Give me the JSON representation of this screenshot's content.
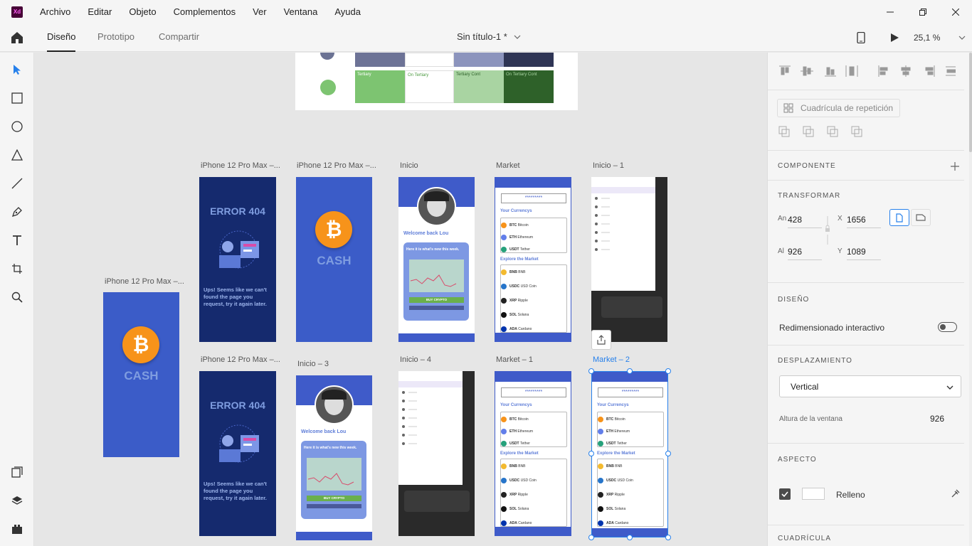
{
  "menubar": {
    "logo": "Xd",
    "items": [
      "Archivo",
      "Editar",
      "Objeto",
      "Complementos",
      "Ver",
      "Ventana",
      "Ayuda"
    ]
  },
  "toolbar": {
    "tabs": [
      "Diseño",
      "Prototipo",
      "Compartir"
    ],
    "doc_title": "Sin título-1 *",
    "zoom": "25,1 %"
  },
  "canvas": {
    "style_guide": {
      "labels": [
        "Tertiary",
        "On Tertiary",
        "Tertiary Cont",
        "On Tertiary Cont"
      ]
    },
    "artboards": {
      "a1": "iPhone 12 Pro Max –...",
      "a2": "iPhone 12 Pro Max –...",
      "a3": "iPhone 12 Pro Max –...",
      "a4": "iPhone 12 Pro Max –...",
      "inicio": "Inicio",
      "market": "Market",
      "inicio1": "Inicio – 1",
      "inicio3": "Inicio – 3",
      "inicio4": "Inicio – 4",
      "market1": "Market – 1",
      "market2": "Market – 2"
    },
    "mock": {
      "cash": "CASH",
      "btc": "₿",
      "error_title": "ERROR 404",
      "error_body": "Ups! Seems like we can't found the page you request, try it again later.",
      "welcome": "Welcome back Lou",
      "news": "Here it is what's new this week.",
      "buy": "BUY CRYPTO",
      "password": "*********",
      "currencies": "Your Currencys",
      "explore": "Explore the Market",
      "coins_top": [
        {
          "sym": "BTC",
          "name": "Bitcoin",
          "color": "#f7931a"
        },
        {
          "sym": "ETH",
          "name": "Ethereum",
          "color": "#627eea"
        },
        {
          "sym": "USDT",
          "name": "Tether",
          "color": "#26a17b"
        }
      ],
      "coins_market": [
        {
          "sym": "BNB",
          "name": "BNB",
          "color": "#f3ba2f"
        },
        {
          "sym": "USDC",
          "name": "USD Coin",
          "color": "#2775ca"
        },
        {
          "sym": "XRP",
          "name": "Ripple",
          "color": "#222222"
        },
        {
          "sym": "SOL",
          "name": "Solana",
          "color": "#111111"
        },
        {
          "sym": "ADA",
          "name": "Cardano",
          "color": "#0033ad"
        }
      ]
    }
  },
  "rightpanel": {
    "repeat_grid": "Cuadrícula de repetición",
    "component_heading": "COMPONENTE",
    "transform_heading": "TRANSFORMAR",
    "width_label": "An",
    "width_value": "428",
    "height_label": "Al",
    "height_value": "926",
    "x_label": "X",
    "x_value": "1656",
    "y_label": "Y",
    "y_value": "1089",
    "layout_heading": "DISEÑO",
    "responsive_resize": "Redimensionado interactivo",
    "scroll_heading": "DESPLAZAMIENTO",
    "scroll_value": "Vertical",
    "viewport_height_label": "Altura de la ventana",
    "viewport_height_value": "926",
    "appearance_heading": "ASPECTO",
    "fill_label": "Relleno",
    "grid_heading": "CUADRÍCULA"
  },
  "colors": {
    "accent": "#2680eb",
    "artboard_blue": "#3b5cc8",
    "artboard_dark": "#152a6e",
    "tertiary": "#7dc471",
    "on_tertiary_cont": "#2e6129"
  }
}
